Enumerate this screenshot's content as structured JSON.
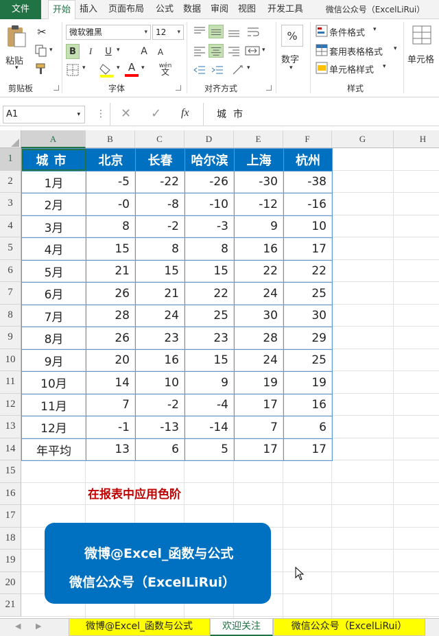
{
  "menu": {
    "tabs": [
      "文件",
      "开始",
      "插入",
      "页面布局",
      "公式",
      "数据",
      "审阅",
      "视图",
      "开发工具",
      "微信公众号（ExcelLiRui）"
    ]
  },
  "ribbon": {
    "clipboard": {
      "paste_label": "粘贴",
      "group_label": "剪贴板"
    },
    "font": {
      "font_name": "微软雅黑",
      "font_size": "12",
      "group_label": "字体",
      "bold": "B",
      "italic": "I",
      "underline": "U",
      "grow": "A",
      "shrink": "A",
      "phonetic": "wén"
    },
    "alignment": {
      "group_label": "对齐方式"
    },
    "number": {
      "label": "数字",
      "percent": "%"
    },
    "styles": {
      "conditional": "条件格式",
      "table_format": "套用表格格式",
      "cell_styles": "单元格样式",
      "group_label": "样式"
    },
    "cells": {
      "label": "单元格"
    }
  },
  "formula_bar": {
    "name_box": "A1",
    "fx": "fx",
    "value": "城市"
  },
  "grid": {
    "columns": [
      "A",
      "B",
      "C",
      "D",
      "E",
      "F",
      "G",
      "H"
    ],
    "rows": [
      "1",
      "2",
      "3",
      "4",
      "5",
      "6",
      "7",
      "8",
      "9",
      "10",
      "11",
      "12",
      "13",
      "14",
      "15",
      "16",
      "17",
      "18",
      "19",
      "20",
      "21"
    ]
  },
  "table": {
    "header": [
      "城市",
      "北京",
      "长春",
      "哈尔滨",
      "上海",
      "杭州"
    ],
    "rows": [
      [
        "1月",
        "-5",
        "-22",
        "-26",
        "-30",
        "-38"
      ],
      [
        "2月",
        "-0",
        "-8",
        "-10",
        "-12",
        "-16"
      ],
      [
        "3月",
        "8",
        "-2",
        "-3",
        "9",
        "10"
      ],
      [
        "4月",
        "15",
        "8",
        "8",
        "16",
        "17"
      ],
      [
        "5月",
        "21",
        "15",
        "15",
        "22",
        "22"
      ],
      [
        "6月",
        "26",
        "21",
        "22",
        "24",
        "25"
      ],
      [
        "7月",
        "28",
        "24",
        "25",
        "30",
        "30"
      ],
      [
        "8月",
        "26",
        "23",
        "23",
        "28",
        "29"
      ],
      [
        "9月",
        "20",
        "16",
        "15",
        "24",
        "25"
      ],
      [
        "10月",
        "14",
        "10",
        "9",
        "19",
        "19"
      ],
      [
        "11月",
        "7",
        "-2",
        "-4",
        "17",
        "16"
      ],
      [
        "12月",
        "-1",
        "-13",
        "-14",
        "7",
        "6"
      ],
      [
        "年平均",
        "13",
        "6",
        "5",
        "17",
        "17"
      ]
    ]
  },
  "note": "在报表中应用色阶",
  "promo": {
    "line1": "微博@Excel_函数与公式",
    "line2": "微信公众号（ExcelLiRui）"
  },
  "sheets": [
    "微博@Excel_函数与公式",
    "欢迎关注",
    "微信公众号（ExcelLiRui）"
  ],
  "colors": {
    "excel_green": "#217346",
    "table_blue": "#0070c0",
    "note_red": "#c00000",
    "tab_yellow": "#ffff00"
  }
}
